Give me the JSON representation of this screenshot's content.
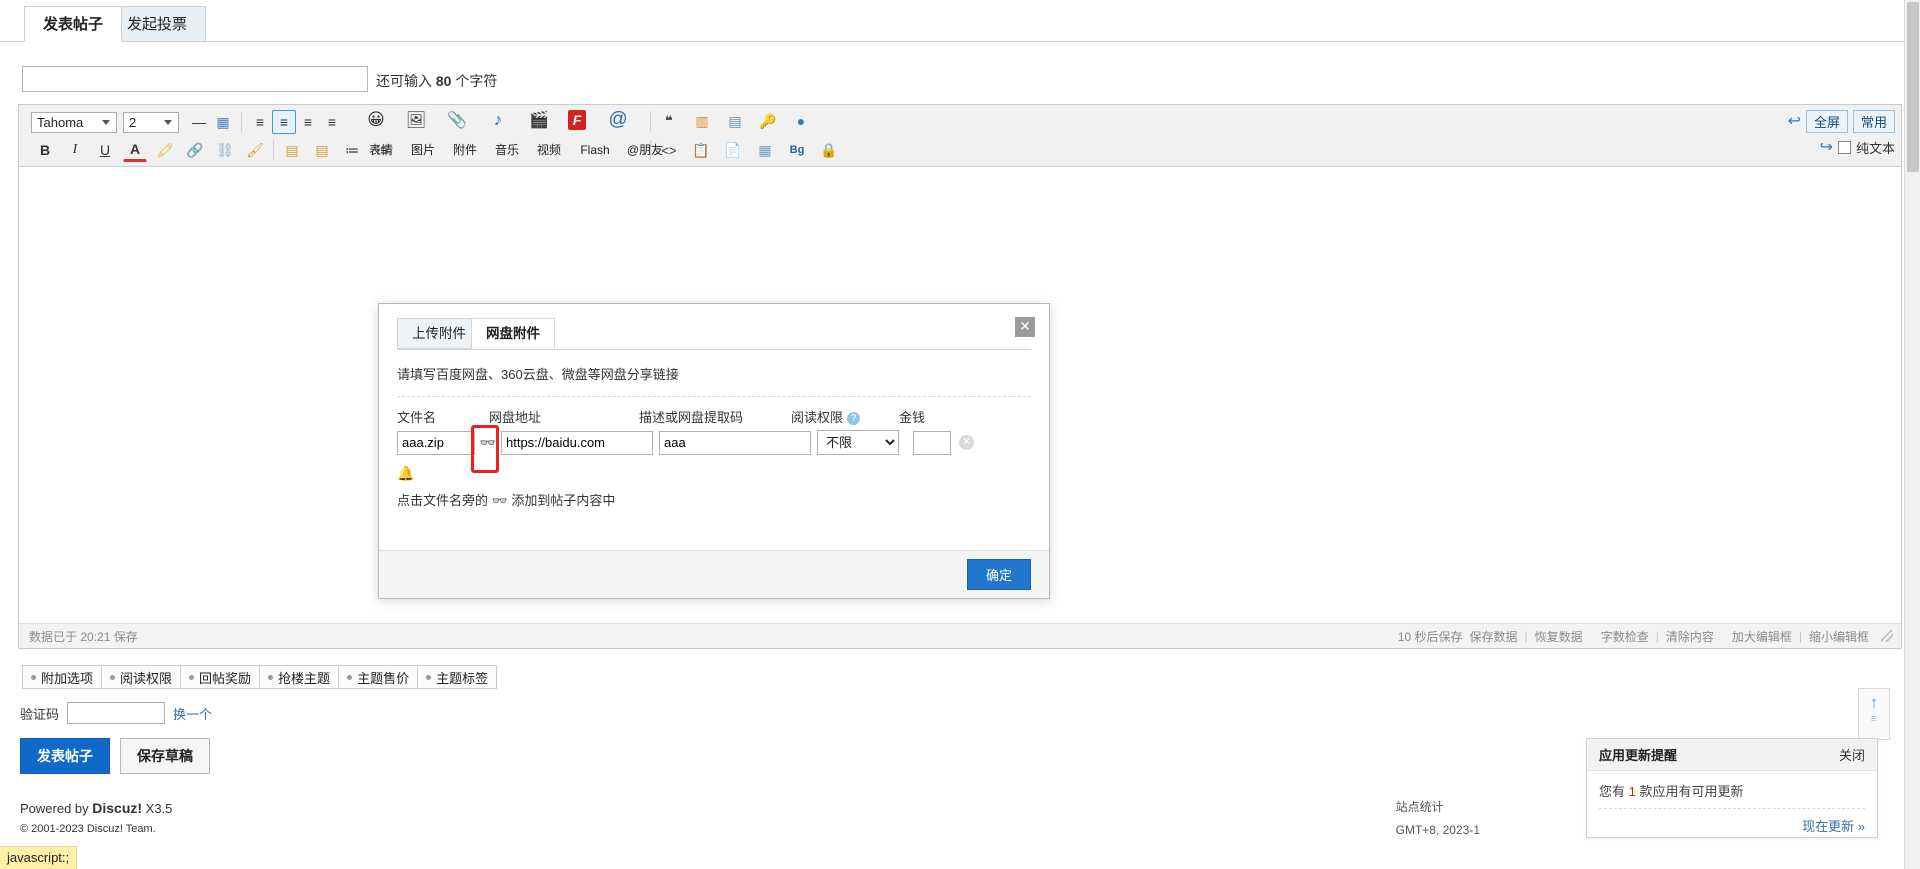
{
  "tabs": [
    {
      "label": "发表帖子",
      "active": true
    },
    {
      "label": "发起投票",
      "active": false
    }
  ],
  "subject": {
    "value": "",
    "placeholder": "",
    "hint_prefix": "还可输入 ",
    "hint_count": "80",
    "hint_suffix": " 个字符"
  },
  "toolbar": {
    "font_family": "Tahoma",
    "font_size": "2",
    "row1_icons": [
      {
        "name": "horizontal-rule-icon",
        "glyph": "—"
      },
      {
        "name": "table-icon",
        "glyph": "▦"
      },
      {
        "name": "align-left-icon",
        "glyph": "≡"
      },
      {
        "name": "align-justify-icon",
        "glyph": "≡"
      },
      {
        "name": "align-center-icon",
        "glyph": "≡"
      },
      {
        "name": "align-right-icon",
        "glyph": "≡"
      }
    ],
    "row1_big": [
      {
        "name": "smiley-icon",
        "glyph": "😀",
        "label": "表情"
      },
      {
        "name": "image-icon",
        "glyph": "🖼",
        "label": "图片"
      },
      {
        "name": "attachment-icon",
        "glyph": "📎",
        "label": "附件"
      },
      {
        "name": "music-icon",
        "glyph": "♪",
        "label": "音乐"
      },
      {
        "name": "video-icon",
        "glyph": "🎬",
        "label": "视频"
      },
      {
        "name": "flash-icon",
        "glyph": "F",
        "label": "Flash"
      },
      {
        "name": "mention-friend-icon",
        "glyph": "@",
        "label": "@朋友"
      }
    ],
    "row1_tail": [
      {
        "name": "quote-icon",
        "glyph": "❝"
      },
      {
        "name": "free-icon",
        "glyph": "▥"
      },
      {
        "name": "hide-icon",
        "glyph": "▤"
      },
      {
        "name": "password-icon",
        "glyph": "🔑"
      },
      {
        "name": "ball-icon",
        "glyph": "●"
      }
    ],
    "row2_icons": [
      {
        "name": "bold-icon",
        "glyph": "B"
      },
      {
        "name": "italic-icon",
        "glyph": "I"
      },
      {
        "name": "underline-icon",
        "glyph": "U"
      },
      {
        "name": "text-color-icon",
        "glyph": "A"
      },
      {
        "name": "highlight-color-icon",
        "glyph": "🖍"
      },
      {
        "name": "insert-link-icon",
        "glyph": "🔗"
      },
      {
        "name": "remove-link-icon",
        "glyph": "⛓"
      },
      {
        "name": "clear-format-icon",
        "glyph": "🖌"
      },
      {
        "name": "outdent-icon",
        "glyph": "▤"
      },
      {
        "name": "indent-icon",
        "glyph": "▤"
      },
      {
        "name": "ordered-list-icon",
        "glyph": "≔"
      },
      {
        "name": "unordered-list-icon",
        "glyph": "⁝≡"
      }
    ],
    "row2_tail": [
      {
        "name": "source-code-icon",
        "glyph": "<>"
      },
      {
        "name": "paste-icon",
        "glyph": "📋"
      },
      {
        "name": "paste-word-icon",
        "glyph": "📄"
      },
      {
        "name": "table-grid-icon",
        "glyph": "▦"
      },
      {
        "name": "background-color-icon",
        "glyph": "Bg"
      },
      {
        "name": "lock-icon",
        "glyph": "🔒"
      }
    ],
    "fullscreen_label": "全屏",
    "common_label": "常用",
    "plaintext_label": "纯文本",
    "undo_glyph": "↩",
    "redo_glyph": "↪"
  },
  "editor_status": {
    "saved_text": "数据已于 20:21 保存",
    "autosave": "10 秒后保存",
    "links": [
      "保存数据",
      "恢复数据",
      "字数检查",
      "清除内容",
      "加大编辑框",
      "缩小编辑框"
    ]
  },
  "options": [
    "附加选项",
    "阅读权限",
    "回帖奖励",
    "抢楼主题",
    "主题售价",
    "主题标签"
  ],
  "seccode": {
    "label": "验证码",
    "value": "",
    "refresh_label": "换一个"
  },
  "submit": {
    "post_label": "发表帖子",
    "draft_label": "保存草稿"
  },
  "footer": {
    "powered_prefix": "Powered by ",
    "powered_brand": "Discuz!",
    "powered_version": " X3.5",
    "copyright": "© 2001-2023 Discuz! Team."
  },
  "sitestat": {
    "line1": "站点统计",
    "line2": "GMT+8, 2023-1"
  },
  "scrolltop": {
    "up_glyph": "↑",
    "bars_glyph": "≡"
  },
  "notice": {
    "title": "应用更新提醒",
    "close_label": "关闭",
    "body_prefix": "您有 ",
    "body_count": "1",
    "body_suffix": " 款应用有可用更新",
    "action_label": "现在更新 »"
  },
  "modal": {
    "tabs": [
      {
        "label": "上传附件",
        "active": false
      },
      {
        "label": "网盘附件",
        "active": true
      }
    ],
    "close_glyph": "✕",
    "description": "请填写百度网盘、360云盘、微盘等网盘分享链接",
    "columns": {
      "filename": "文件名",
      "url": "网盘地址",
      "desc": "描述或网盘提取码",
      "permission": "阅读权限",
      "money": "金钱"
    },
    "help_glyph": "?",
    "row": {
      "filename": "aaa.zip",
      "link_icon_glyph": "👓",
      "url": "https://baidu.com",
      "desc": "aaa",
      "permission": "不限",
      "permission_options": [
        "不限"
      ],
      "money": "",
      "delete_glyph": "✕"
    },
    "bell_glyph": "🔔",
    "tip_prefix": "点击文件名旁的 ",
    "tip_icon_glyph": "👓",
    "tip_suffix": " 添加到帖子内容中",
    "confirm_label": "确定"
  },
  "statusbar_url": "javascript:;",
  "colors": {
    "accent": "#1069c9",
    "modal_ok": "#2277cc",
    "highlight_red": "#f02020",
    "link": "#3a6ea5",
    "status_yellow": "#fdf0a8"
  }
}
